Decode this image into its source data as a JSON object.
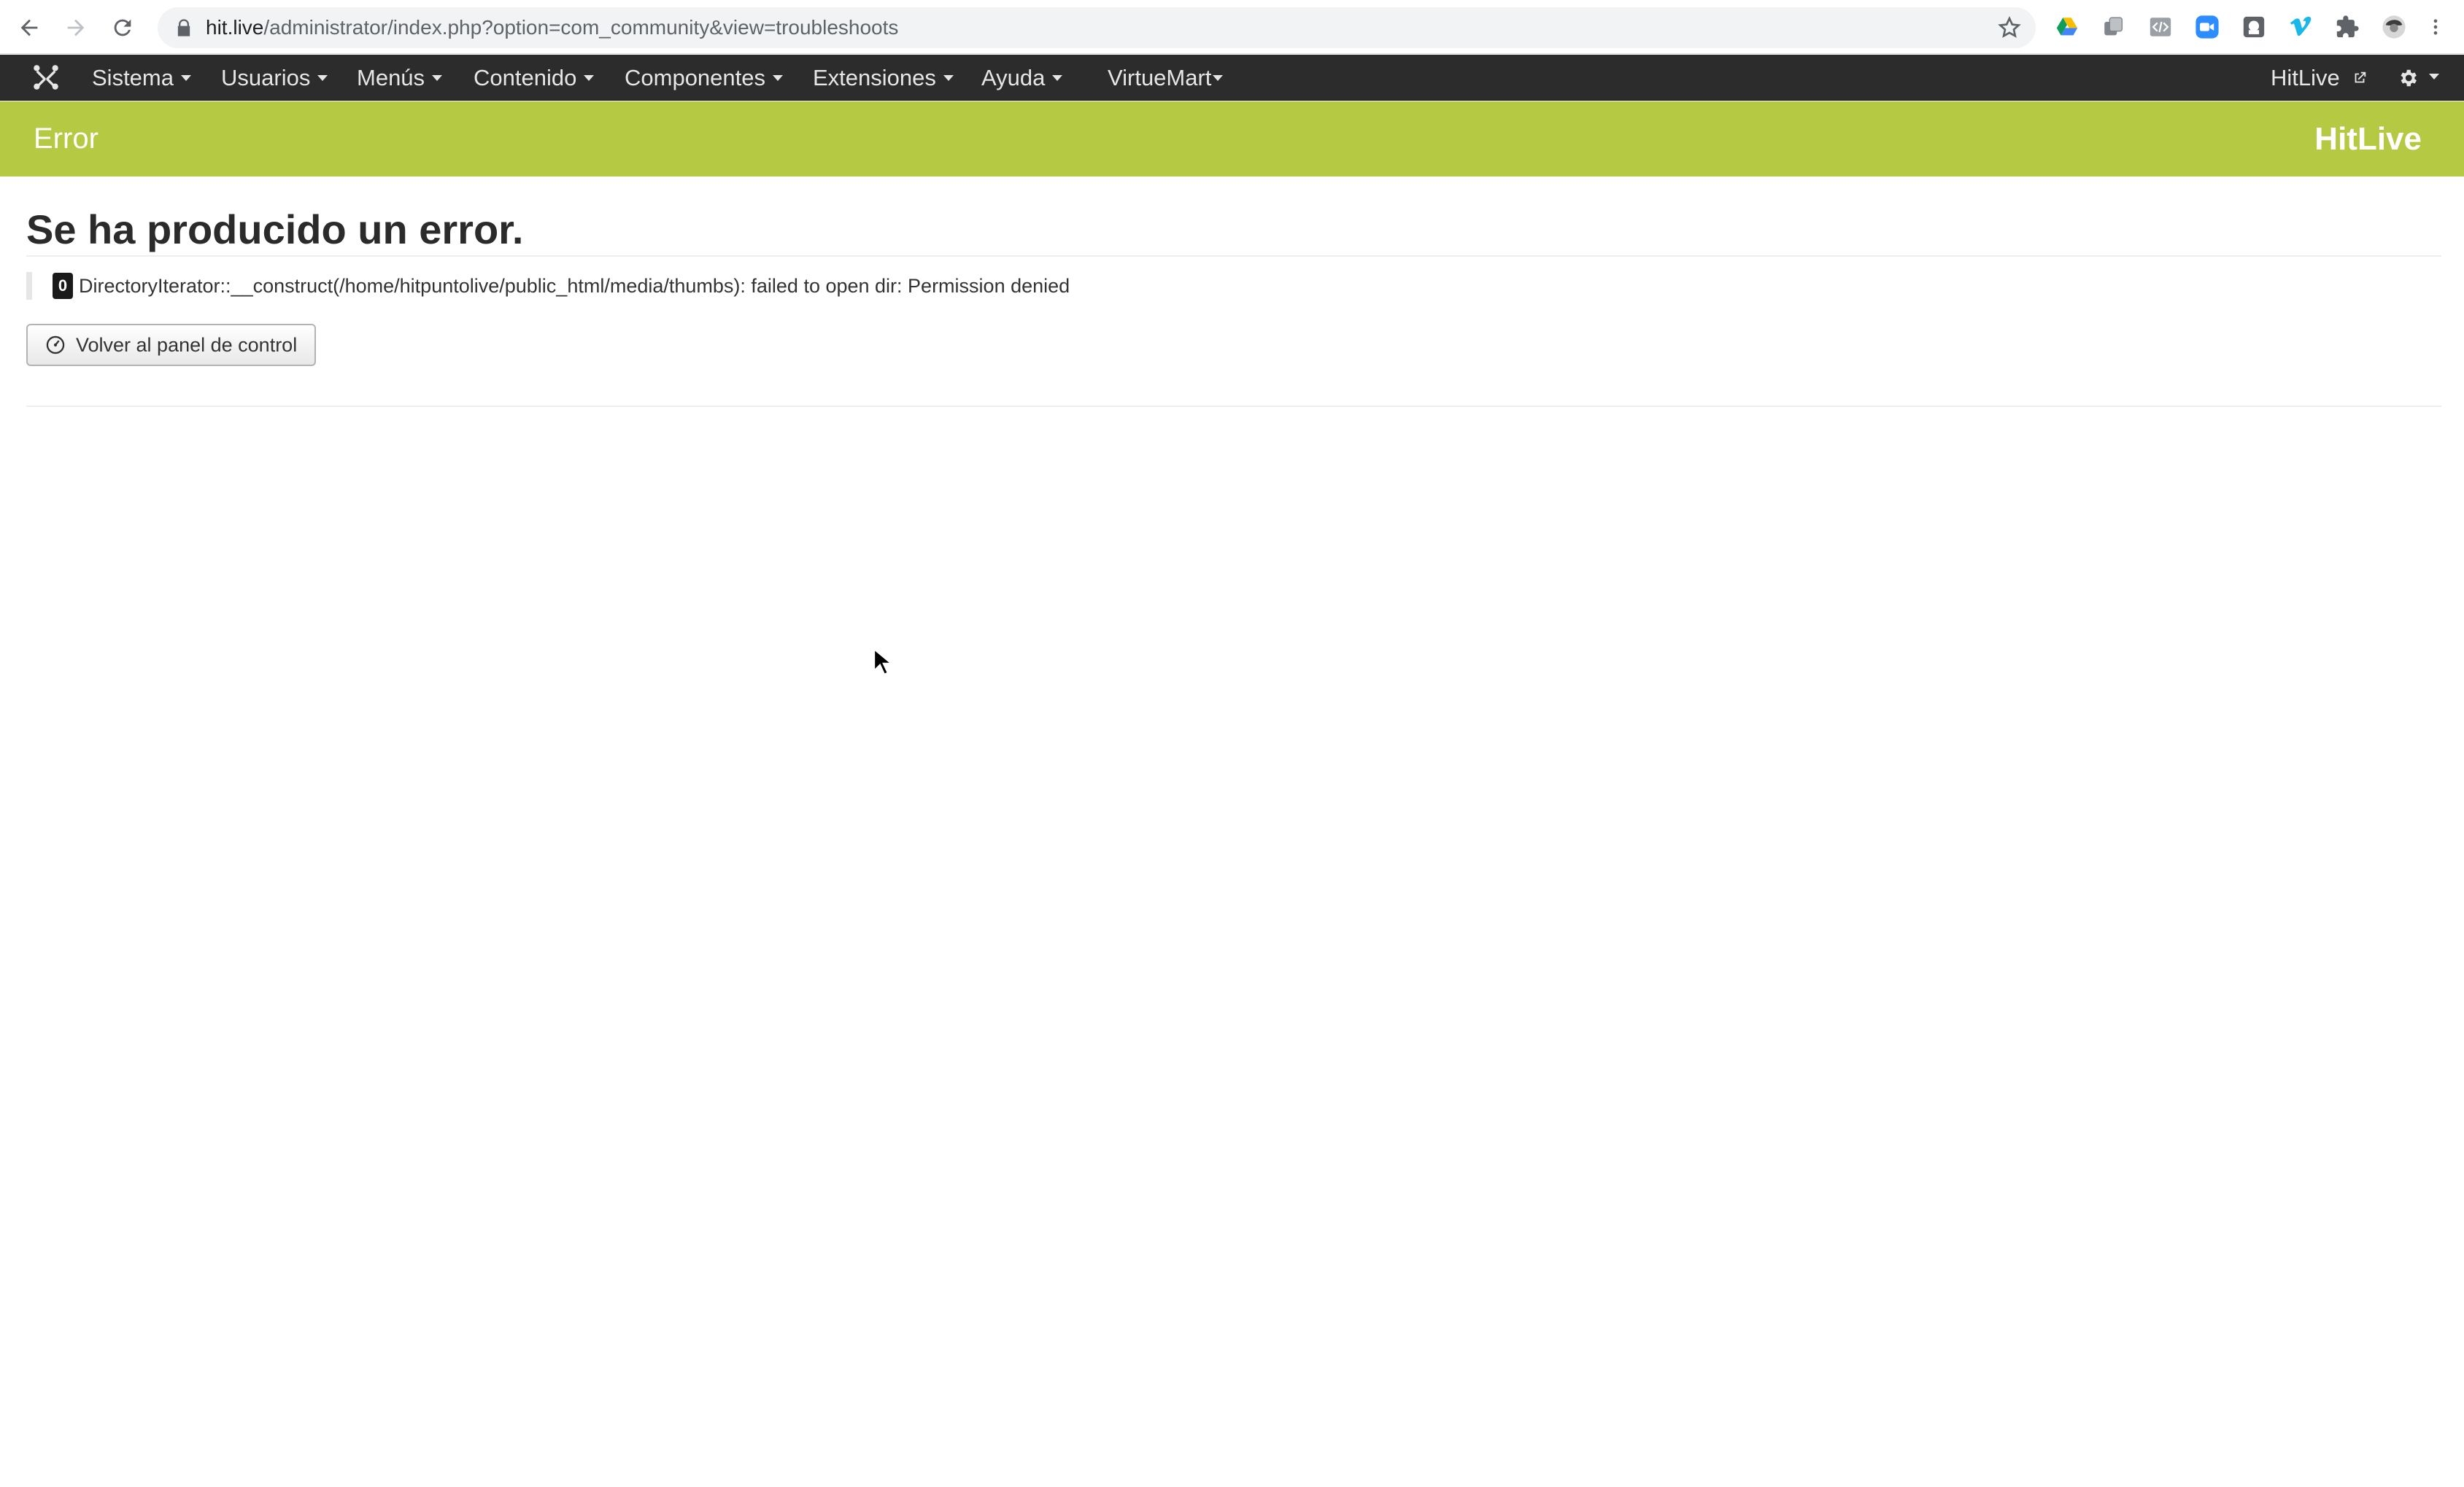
{
  "browser": {
    "url_host": "hit.live",
    "url_path": "/administrator/index.php?option=com_community&view=troubleshoots",
    "extensions": [
      "google-drive-icon",
      "copy-extension-icon",
      "code-extension-icon",
      "zoom-icon",
      "puzzle-square-icon",
      "vimeo-icon",
      "extensions-puzzle-icon",
      "profile-avatar",
      "more-vert-icon"
    ]
  },
  "topnav": {
    "items": [
      {
        "label": "Sistema"
      },
      {
        "label": "Usuarios"
      },
      {
        "label": "Menús"
      },
      {
        "label": "Contenido"
      },
      {
        "label": "Componentes"
      },
      {
        "label": "Extensiones"
      },
      {
        "label": "Ayuda"
      },
      {
        "label": "VirtueMart"
      }
    ],
    "site_link": "HitLive"
  },
  "header": {
    "title": "Error",
    "site_name": "HitLive",
    "color": "#b5c943"
  },
  "content": {
    "heading": "Se ha producido un error.",
    "error_code": "0",
    "error_message": "DirectoryIterator::__construct(/home/hitpuntolive/public_html/media/thumbs): failed to open dir: Permission denied",
    "back_button": "Volver al panel de control"
  }
}
